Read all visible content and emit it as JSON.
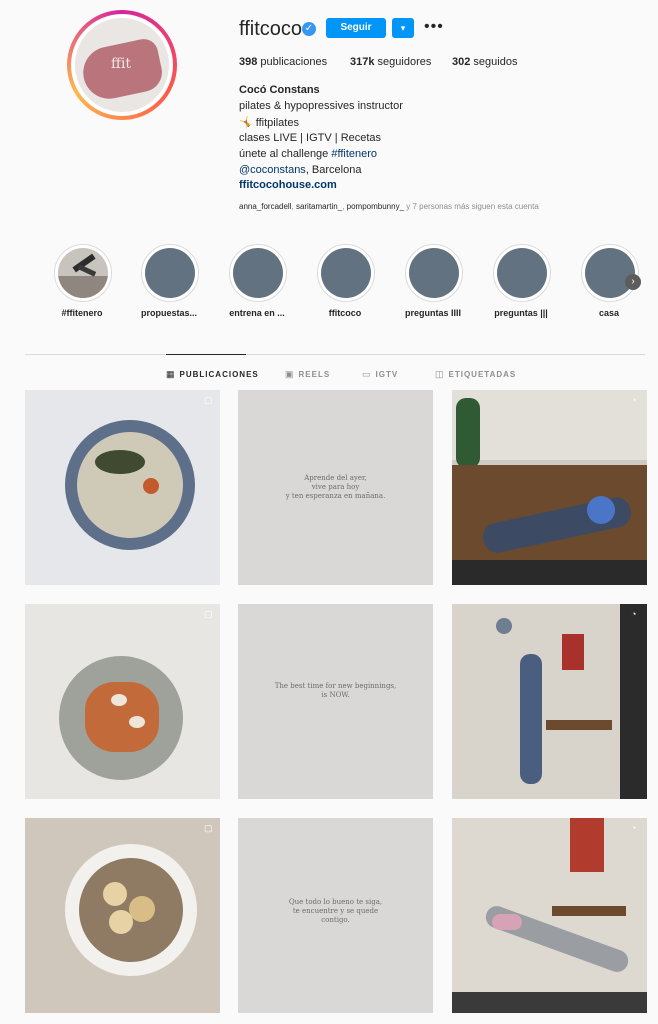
{
  "profile": {
    "username": "ffitcoco",
    "follow_label": "Seguir",
    "dropdown_icon": "▾",
    "more_icon": "•••",
    "avatar_text": "ffit",
    "stats": {
      "posts_num": "398",
      "posts_label": "publicaciones",
      "followers_num": "317k",
      "followers_label": "seguidores",
      "following_num": "302",
      "following_label": "seguidos"
    },
    "full_name": "Cocó Constans",
    "bio": {
      "line1": "pilates & hypopressives instructor",
      "line2_icon": "🤸",
      "line2_text": "ffitpilates",
      "line3": "clases LIVE | IGTV | Recetas",
      "line4_prefix": "únete al challenge ",
      "line4_tag": "#ffitenero",
      "line5_tag": "@coconstans",
      "line5_suffix": ", Barcelona"
    },
    "website": "ffitcocohouse.com",
    "followed_by": {
      "u1": "anna_forcadell",
      "u2": "saritamartin_",
      "u3": "pompombunny_",
      "suffix": "y 7 personas más siguen esta cuenta"
    }
  },
  "highlights": [
    {
      "label": "#ffitenero"
    },
    {
      "label": "propuestas..."
    },
    {
      "label": "entrena en ..."
    },
    {
      "label": "ffitcoco"
    },
    {
      "label": "preguntas IIII"
    },
    {
      "label": "preguntas |||"
    },
    {
      "label": "casa"
    }
  ],
  "highlight_next_icon": "›",
  "tabs": [
    {
      "label": "PUBLICACIONES",
      "icon": "▦"
    },
    {
      "label": "REELS",
      "icon": "▣"
    },
    {
      "label": "IGTV",
      "icon": "▭"
    },
    {
      "label": "ETIQUETADAS",
      "icon": "◫"
    }
  ],
  "posts": {
    "q1": "Aprende del ayer,\nvive para hoy\ny ten esperanza en mañana.",
    "q2": "The best time for new beginnings,\nis NOW.",
    "q3": "Que todo lo bueno te siga,\nte encuentre y se quede\ncontigo."
  },
  "colors": {
    "accent": "#0095f6",
    "link": "#00376b",
    "highlight_cover": "#637280"
  }
}
